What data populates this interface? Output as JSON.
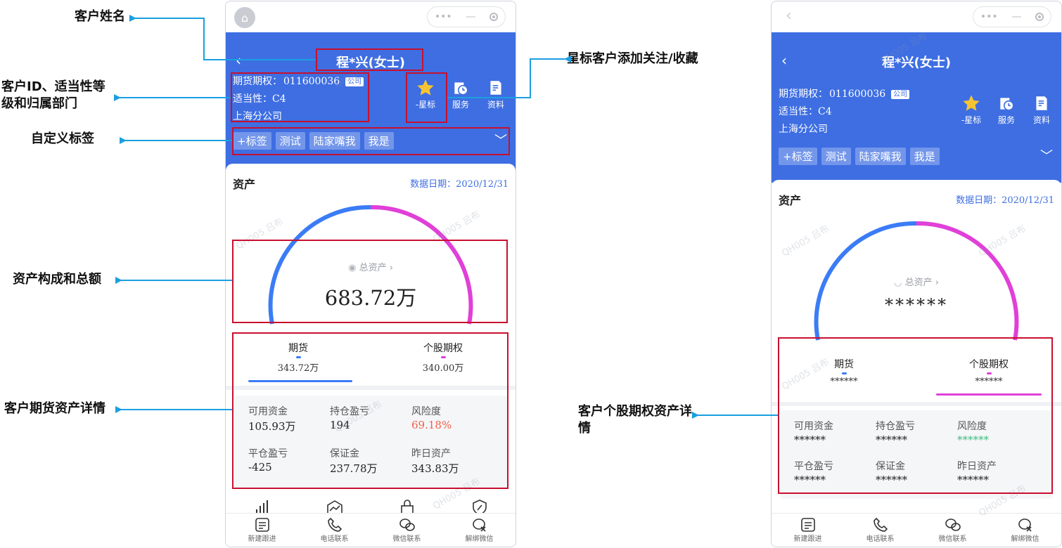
{
  "annotations": {
    "customer_name": "客户姓名",
    "customer_id": "客户ID、适当性等级和归属部门",
    "custom_tags": "自定义标签",
    "asset_summary": "资产构成和总额",
    "futures_detail": "客户期货资产详情",
    "star_customer": "星标客户添加关注/收藏",
    "option_detail": "客户个股期权资产详情"
  },
  "watermark": "QH005 吕布",
  "left_phone": {
    "customer_name": "程*兴(女士)",
    "account_label": "期货期权：",
    "account_id": "011600036",
    "account_badge": "公司",
    "suitability": "适当性：C4",
    "branch": "上海分公司",
    "actions": [
      {
        "label": "-星标",
        "icon": "star-icon"
      },
      {
        "label": "服务",
        "icon": "service-icon"
      },
      {
        "label": "资料",
        "icon": "document-icon"
      }
    ],
    "tags": [
      "+标签",
      "测试",
      "陆家嘴我",
      "我是"
    ],
    "asset_title": "资产",
    "data_date": "数据日期：2020/12/31",
    "total_label": "总资产 ›",
    "total_value": "683.72万",
    "tabs": [
      {
        "name": "期货",
        "value": "343.72万",
        "active": true
      },
      {
        "name": "个股期权",
        "value": "340.00万",
        "active": false
      }
    ],
    "details": [
      {
        "label": "可用资金",
        "value": "105.93万"
      },
      {
        "label": "持仓盈亏",
        "value": "194"
      },
      {
        "label": "风险度",
        "value": "69.18%",
        "color": "#f0604a"
      },
      {
        "label": "平仓盈亏",
        "value": "-425"
      },
      {
        "label": "保证金",
        "value": "237.78万"
      },
      {
        "label": "昨日资产",
        "value": "343.83万"
      }
    ],
    "bottom_bar": [
      "新建跟进",
      "电话联系",
      "微信联系",
      "解绑微信"
    ]
  },
  "right_phone": {
    "customer_name": "程*兴(女士)",
    "account_label": "期货期权：",
    "account_id": "011600036",
    "account_badge": "公司",
    "suitability": "适当性：C4",
    "branch": "上海分公司",
    "actions": [
      {
        "label": "-星标",
        "icon": "star-icon"
      },
      {
        "label": "服务",
        "icon": "service-icon"
      },
      {
        "label": "资料",
        "icon": "document-icon"
      }
    ],
    "tags": [
      "+标签",
      "测试",
      "陆家嘴我",
      "我是"
    ],
    "asset_title": "资产",
    "data_date": "数据日期：2020/12/31",
    "total_label": "总资产 ›",
    "total_value": "******",
    "tabs": [
      {
        "name": "期货",
        "value": "******",
        "active": false
      },
      {
        "name": "个股期权",
        "value": "******",
        "active": true
      }
    ],
    "details": [
      {
        "label": "可用资金",
        "value": "******"
      },
      {
        "label": "持仓盈亏",
        "value": "******"
      },
      {
        "label": "风险度",
        "value": "******",
        "color": "#3fbf7f"
      },
      {
        "label": "平仓盈亏",
        "value": "******"
      },
      {
        "label": "保证金",
        "value": "******"
      },
      {
        "label": "昨日资产",
        "value": "******"
      }
    ],
    "bottom_bar": [
      "新建跟进",
      "电话联系",
      "微信联系",
      "解绑微信"
    ]
  },
  "colors": {
    "header_blue": "#3e6ee2",
    "futures_blue": "#3b7cf6",
    "options_magenta": "#e040d8",
    "annotation_red": "#c8102e",
    "arrow_cyan": "#1a9fe0"
  }
}
